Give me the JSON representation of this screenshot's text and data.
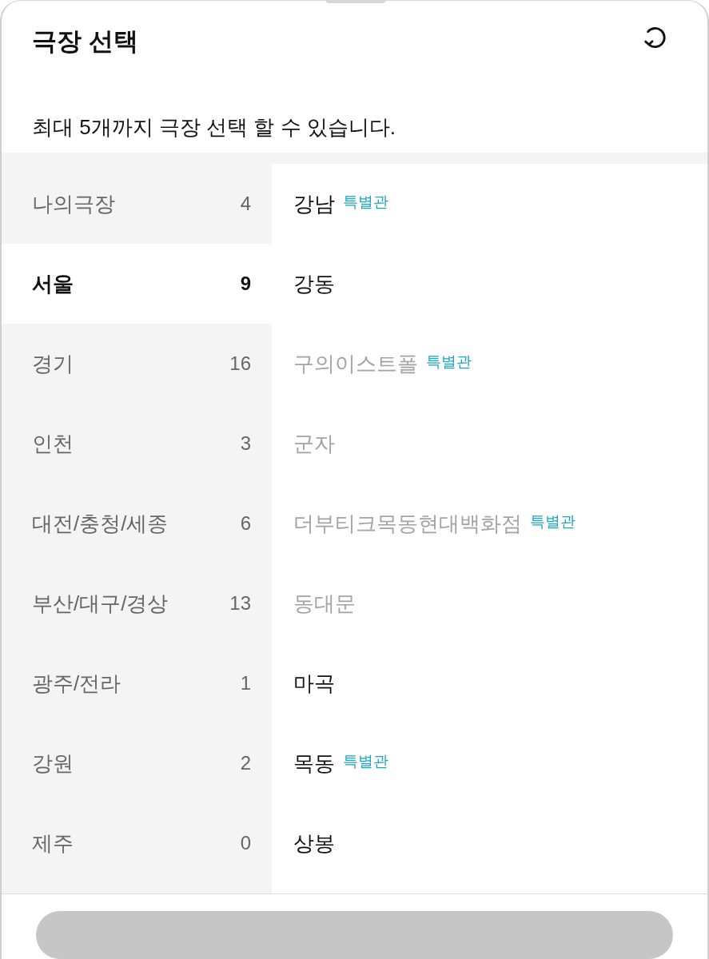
{
  "sheet": {
    "title": "극장 선택",
    "notice": "최대 5개까지 극장 선택 할 수 있습니다."
  },
  "regions": [
    {
      "name": "나의극장",
      "count": "4",
      "selected": false
    },
    {
      "name": "서울",
      "count": "9",
      "selected": true
    },
    {
      "name": "경기",
      "count": "16",
      "selected": false
    },
    {
      "name": "인천",
      "count": "3",
      "selected": false
    },
    {
      "name": "대전/충청/세종",
      "count": "6",
      "selected": false
    },
    {
      "name": "부산/대구/경상",
      "count": "13",
      "selected": false
    },
    {
      "name": "광주/전라",
      "count": "1",
      "selected": false
    },
    {
      "name": "강원",
      "count": "2",
      "selected": false
    },
    {
      "name": "제주",
      "count": "0",
      "selected": false
    }
  ],
  "theaters": [
    {
      "name": "강남",
      "badge": "특별관",
      "disabled": false
    },
    {
      "name": "강동",
      "disabled": false
    },
    {
      "name": "구의이스트폴",
      "badge": "특별관",
      "disabled": true
    },
    {
      "name": "군자",
      "disabled": true
    },
    {
      "name": "더부티크목동현대백화점",
      "badge": "특별관",
      "disabled": true
    },
    {
      "name": "동대문",
      "disabled": true
    },
    {
      "name": "마곡",
      "disabled": false
    },
    {
      "name": "목동",
      "badge": "특별관",
      "disabled": false
    },
    {
      "name": "상봉",
      "disabled": false
    }
  ]
}
